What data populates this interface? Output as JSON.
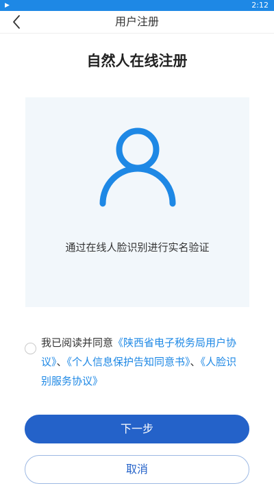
{
  "status_bar": {
    "time": "2:12",
    "play_icon": "▶"
  },
  "nav": {
    "title": "用户注册",
    "back_icon": "chevron-left-icon"
  },
  "heading": "自然人在线注册",
  "face_panel": {
    "hint": "通过在线人脸识别进行实名验证",
    "icon": "user-avatar-icon"
  },
  "agreement": {
    "prefix": "我已阅读并同意",
    "link_1": "《陕西省电子税务局用户协议》",
    "sep_1": "、",
    "link_2": "《个人信息保护告知同意书》",
    "sep_2": "、",
    "link_3": "《人脸识别服务协议》",
    "checked": false
  },
  "buttons": {
    "next_label": "下一步",
    "cancel_label": "取消"
  },
  "colors": {
    "accent": "#1e88e5",
    "primary_button": "#2462c9",
    "panel_bg": "#f2f7fb"
  }
}
